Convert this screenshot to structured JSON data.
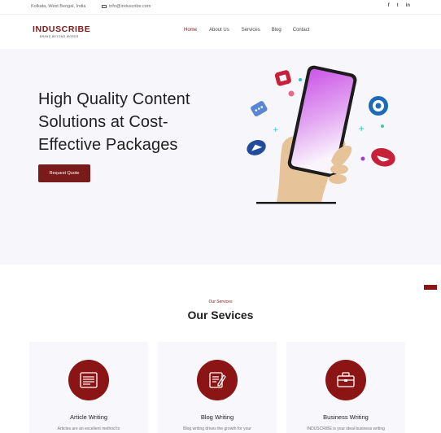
{
  "topbar": {
    "location": "Kolkata, West Bengal, India",
    "email": "info@induscribe.com",
    "social": [
      "f",
      "t",
      "in"
    ]
  },
  "header": {
    "logo_text": "INDUSCRIBE",
    "logo_tagline": "BRAND BEYOND WORDS",
    "nav": [
      "Home",
      "About Us",
      "Services",
      "Blog",
      "Contact"
    ],
    "active_nav": "Home"
  },
  "hero": {
    "title": "High Quality Content Solutions at Cost-Effective Packages",
    "cta": "Request Quote"
  },
  "services": {
    "eyebrow": "Our Services",
    "heading": "Our Sevices",
    "cards": [
      {
        "title": "Article Writing",
        "desc": "Articles are an excellent method to",
        "icon": "article-icon"
      },
      {
        "title": "Blog Writing",
        "desc": "Blog writing drives the growth for your",
        "icon": "blog-icon"
      },
      {
        "title": "Business Writing",
        "desc": "INDUSCRIBE is your ideal business writing",
        "icon": "briefcase-icon"
      }
    ]
  },
  "colors": {
    "accent": "#8b1414",
    "hero_bg": "#f6f6fb",
    "card_bg": "#f7f7fc"
  }
}
